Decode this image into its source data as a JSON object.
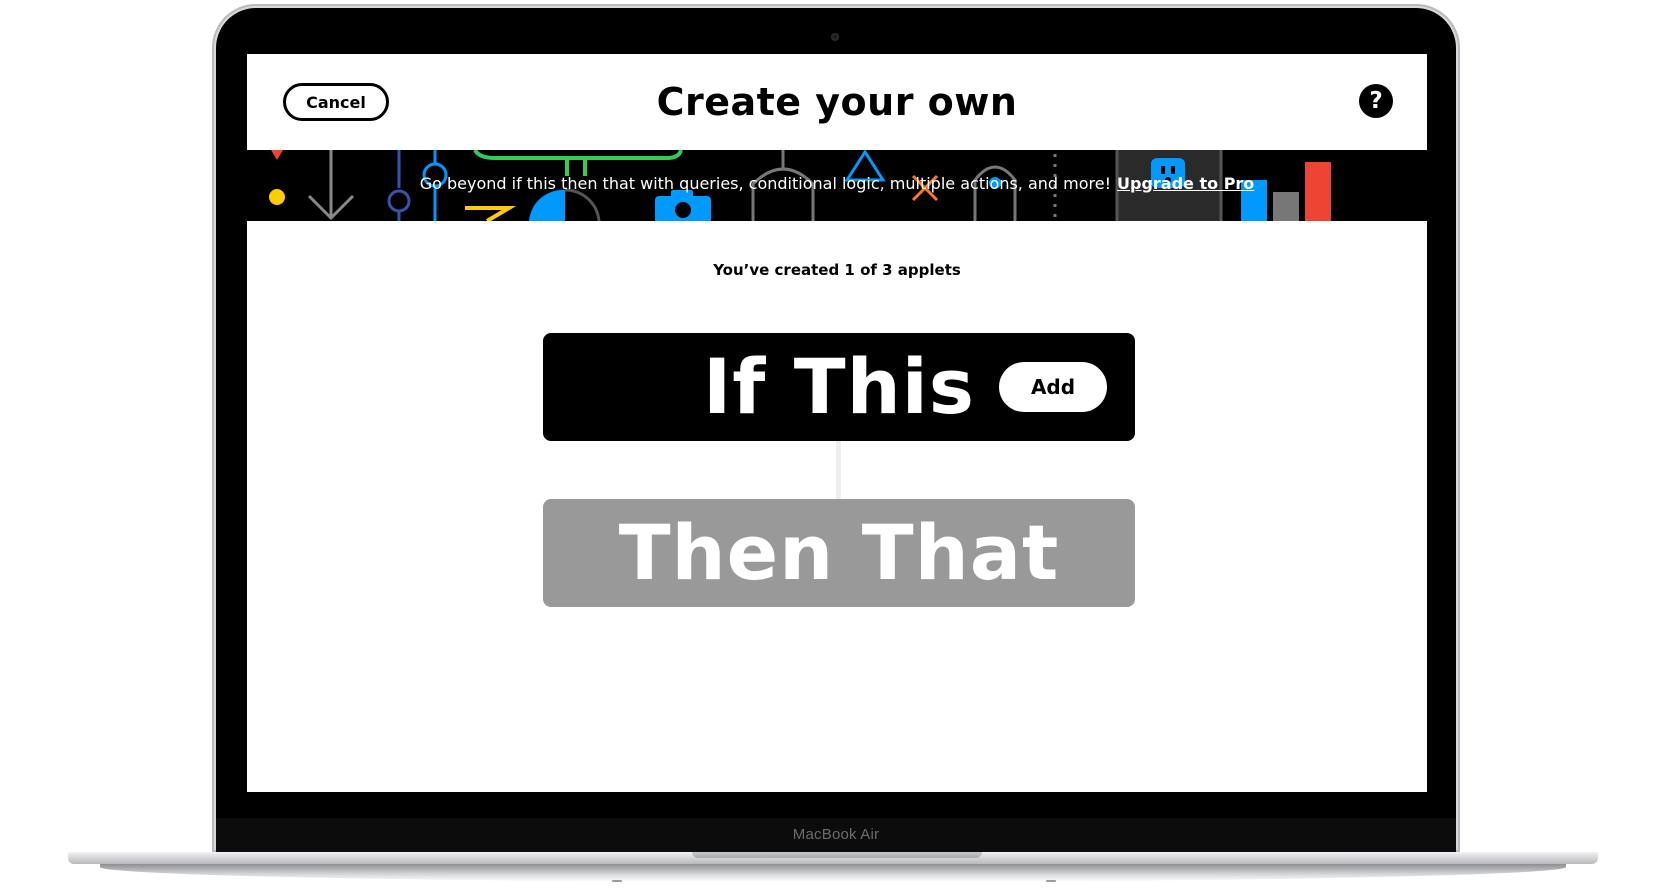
{
  "device": {
    "model_label": "MacBook Air"
  },
  "header": {
    "cancel_label": "Cancel",
    "title": "Create your own",
    "help_icon": "question-icon",
    "help_glyph": "?"
  },
  "banner": {
    "message": "Go beyond if this then that with queries, conditional logic, multiple actions, and more!",
    "link_label": "Upgrade to Pro"
  },
  "main": {
    "applet_count": "You’ve created 1 of 3 applets",
    "trigger": {
      "label": "If This",
      "add_label": "Add"
    },
    "action": {
      "label": "Then That"
    }
  },
  "colors": {
    "trigger_bg": "#000000",
    "action_bg": "#999999",
    "banner_bg": "#000000",
    "accent_blue": "#0099ff",
    "accent_red": "#ee4433",
    "accent_yellow": "#ffcc00",
    "accent_green": "#33cc55"
  }
}
